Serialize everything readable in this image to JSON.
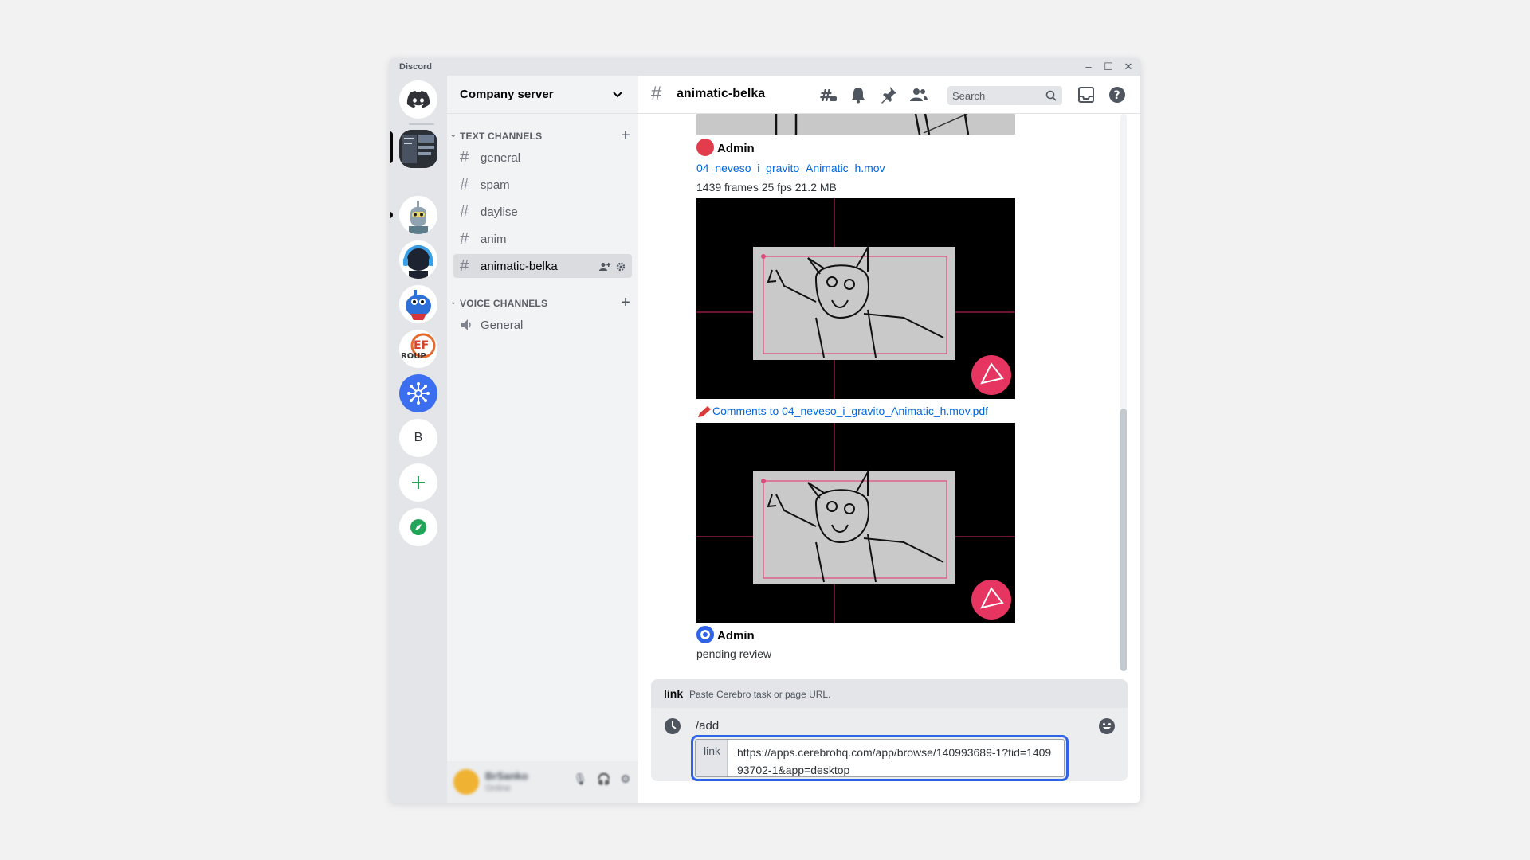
{
  "app": {
    "title": "Discord"
  },
  "window_controls": {
    "minimize": "–",
    "maximize": "☐",
    "close": "✕"
  },
  "rail": {
    "servers": [
      {
        "name": "home",
        "icon": "discord-logo-icon"
      },
      {
        "name": "server-1",
        "icon": "screenshot-thumbnail"
      },
      {
        "name": "server-2",
        "icon": "robot-avatar"
      },
      {
        "name": "server-3",
        "icon": "headset-avatar"
      },
      {
        "name": "server-4",
        "icon": "blue-creature-avatar"
      },
      {
        "name": "server-5",
        "icon": "efgroup-logo"
      },
      {
        "name": "server-6",
        "icon": "network-hub-icon"
      },
      {
        "name": "server-7",
        "letter": "B"
      },
      {
        "name": "add-server",
        "icon": "plus-icon"
      },
      {
        "name": "explore",
        "icon": "compass-icon"
      }
    ]
  },
  "sidebar": {
    "server_name": "Company server",
    "text_category": "TEXT CHANNELS",
    "voice_category": "VOICE CHANNELS",
    "text_channels": [
      "general",
      "spam",
      "daylise",
      "anim",
      "animatic-belka"
    ],
    "active_channel": "animatic-belka",
    "voice_channels": [
      "General"
    ],
    "user": {
      "name": "BrSanko",
      "status": "Online"
    }
  },
  "header": {
    "channel": "animatic-belka",
    "search_placeholder": "Search"
  },
  "messages": {
    "msg1": {
      "author": "Admin",
      "author_color": "#e33c4d",
      "file_link": "04_neveso_i_gravito_Animatic_h.mov",
      "file_meta": "1439 frames 25 fps 21.2 MB"
    },
    "msg2_link": "Comments to 04_neveso_i_gravito_Animatic_h.mov.pdf",
    "msg3": {
      "author": "Admin",
      "author_color": "#2f63e8",
      "text": "pending review"
    }
  },
  "composer": {
    "option_name": "link",
    "option_desc": "Paste Cerebro task or page URL.",
    "command": "/add",
    "field_prefix": "link",
    "field_value": "https://apps.cerebrohq.com/app/browse/140993689-1?tid=140993702-1&app=desktop"
  },
  "colors": {
    "accent": "#2f63e8",
    "link": "#0068e0",
    "brand": "#5865f2"
  }
}
